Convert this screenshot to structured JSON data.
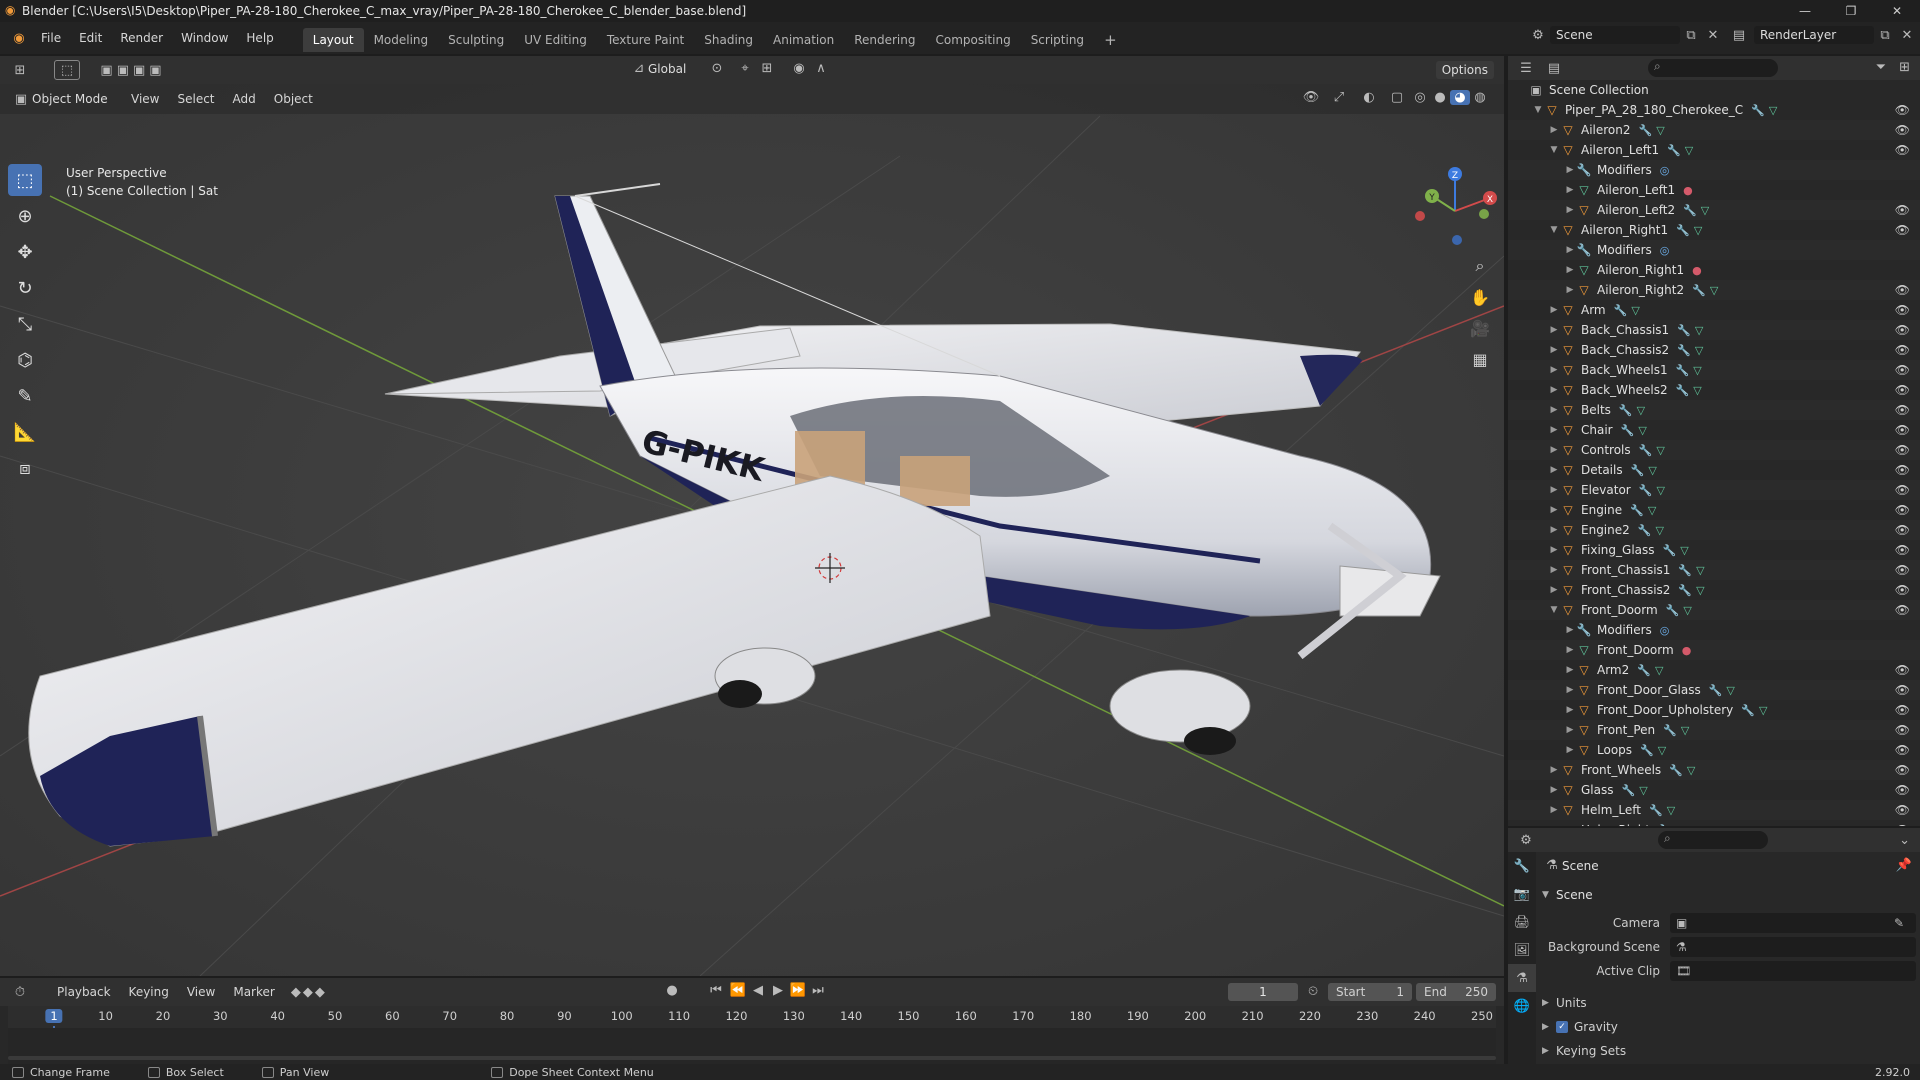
{
  "window": {
    "title": "Blender [C:\\Users\\I5\\Desktop\\Piper_PA-28-180_Cherokee_C_max_vray/Piper_PA-28-180_Cherokee_C_blender_base.blend]"
  },
  "menus": [
    "File",
    "Edit",
    "Render",
    "Window",
    "Help"
  ],
  "workspaces": [
    "Layout",
    "Modeling",
    "Sculpting",
    "UV Editing",
    "Texture Paint",
    "Shading",
    "Animation",
    "Rendering",
    "Compositing",
    "Scripting"
  ],
  "active_workspace": "Layout",
  "scene_selector": "Scene",
  "renderlayer_selector": "RenderLayer",
  "viewport": {
    "mode": "Object Mode",
    "menus": [
      "View",
      "Select",
      "Add",
      "Object"
    ],
    "orientation": "Global",
    "options_label": "Options",
    "info_line1": "User Perspective",
    "info_line2": "(1) Scene Collection | Sat",
    "tail_number": "G-PIKK",
    "gizmo_axes": [
      "X",
      "Y",
      "Z"
    ]
  },
  "outliner": {
    "root": "Scene Collection",
    "items": [
      {
        "label": "Piper_PA_28_180_Cherokee_C",
        "depth": 1,
        "type": "object",
        "expanded": true,
        "eye": true
      },
      {
        "label": "Aileron2",
        "depth": 2,
        "type": "object",
        "eye": true
      },
      {
        "label": "Aileron_Left1",
        "depth": 2,
        "type": "object",
        "expanded": true,
        "eye": true
      },
      {
        "label": "Modifiers",
        "depth": 3,
        "type": "mod",
        "eye": false
      },
      {
        "label": "Aileron_Left1",
        "depth": 3,
        "type": "mesh",
        "eye": false
      },
      {
        "label": "Aileron_Left2",
        "depth": 3,
        "type": "object",
        "eye": true
      },
      {
        "label": "Aileron_Right1",
        "depth": 2,
        "type": "object",
        "expanded": true,
        "eye": true
      },
      {
        "label": "Modifiers",
        "depth": 3,
        "type": "mod",
        "eye": false
      },
      {
        "label": "Aileron_Right1",
        "depth": 3,
        "type": "mesh",
        "eye": false
      },
      {
        "label": "Aileron_Right2",
        "depth": 3,
        "type": "object",
        "eye": true
      },
      {
        "label": "Arm",
        "depth": 2,
        "type": "object",
        "eye": true
      },
      {
        "label": "Back_Chassis1",
        "depth": 2,
        "type": "object",
        "eye": true
      },
      {
        "label": "Back_Chassis2",
        "depth": 2,
        "type": "object",
        "eye": true
      },
      {
        "label": "Back_Wheels1",
        "depth": 2,
        "type": "object",
        "eye": true
      },
      {
        "label": "Back_Wheels2",
        "depth": 2,
        "type": "object",
        "eye": true
      },
      {
        "label": "Belts",
        "depth": 2,
        "type": "object",
        "eye": true
      },
      {
        "label": "Chair",
        "depth": 2,
        "type": "object",
        "eye": true
      },
      {
        "label": "Controls",
        "depth": 2,
        "type": "object",
        "eye": true
      },
      {
        "label": "Details",
        "depth": 2,
        "type": "object",
        "eye": true
      },
      {
        "label": "Elevator",
        "depth": 2,
        "type": "object",
        "eye": true
      },
      {
        "label": "Engine",
        "depth": 2,
        "type": "object",
        "eye": true
      },
      {
        "label": "Engine2",
        "depth": 2,
        "type": "object",
        "eye": true
      },
      {
        "label": "Fixing_Glass",
        "depth": 2,
        "type": "object",
        "eye": true
      },
      {
        "label": "Front_Chassis1",
        "depth": 2,
        "type": "object",
        "eye": true
      },
      {
        "label": "Front_Chassis2",
        "depth": 2,
        "type": "object",
        "eye": true
      },
      {
        "label": "Front_Doorm",
        "depth": 2,
        "type": "object",
        "expanded": true,
        "eye": true
      },
      {
        "label": "Modifiers",
        "depth": 3,
        "type": "mod",
        "eye": false
      },
      {
        "label": "Front_Doorm",
        "depth": 3,
        "type": "mesh",
        "eye": false
      },
      {
        "label": "Arm2",
        "depth": 3,
        "type": "object",
        "eye": true
      },
      {
        "label": "Front_Door_Glass",
        "depth": 3,
        "type": "object",
        "eye": true
      },
      {
        "label": "Front_Door_Upholstery",
        "depth": 3,
        "type": "object",
        "eye": true
      },
      {
        "label": "Front_Pen",
        "depth": 3,
        "type": "object",
        "eye": true
      },
      {
        "label": "Loops",
        "depth": 3,
        "type": "object",
        "eye": true
      },
      {
        "label": "Front_Wheels",
        "depth": 2,
        "type": "object",
        "eye": true
      },
      {
        "label": "Glass",
        "depth": 2,
        "type": "object",
        "eye": true
      },
      {
        "label": "Helm_Left",
        "depth": 2,
        "type": "object",
        "eye": true
      },
      {
        "label": "Helm_Right",
        "depth": 2,
        "type": "object",
        "eye": true
      }
    ]
  },
  "properties": {
    "context": "Scene",
    "panel": "Scene",
    "camera_label": "Camera",
    "background_scene_label": "Background Scene",
    "active_clip_label": "Active Clip",
    "units_label": "Units",
    "gravity_label": "Gravity",
    "gravity_checked": true,
    "keying_sets_label": "Keying Sets"
  },
  "timeline": {
    "menus": [
      "Playback",
      "Keying",
      "View",
      "Marker"
    ],
    "current_frame": "1",
    "start_label": "Start",
    "start": "1",
    "end_label": "End",
    "end": "250",
    "ruler_ticks": [
      "1",
      "10",
      "20",
      "30",
      "40",
      "50",
      "60",
      "70",
      "80",
      "90",
      "100",
      "110",
      "120",
      "130",
      "140",
      "150",
      "160",
      "170",
      "180",
      "190",
      "200",
      "210",
      "220",
      "230",
      "240",
      "250"
    ]
  },
  "statusbar": {
    "items": [
      "Change Frame",
      "Box Select",
      "Pan View",
      "Dope Sheet Context Menu"
    ],
    "version": "2.92.0"
  },
  "colors": {
    "accent": "#4772b3",
    "object_icon": "#f09a3a",
    "mesh_icon": "#5fc39a",
    "modifier_icon": "#7aa0e6"
  }
}
